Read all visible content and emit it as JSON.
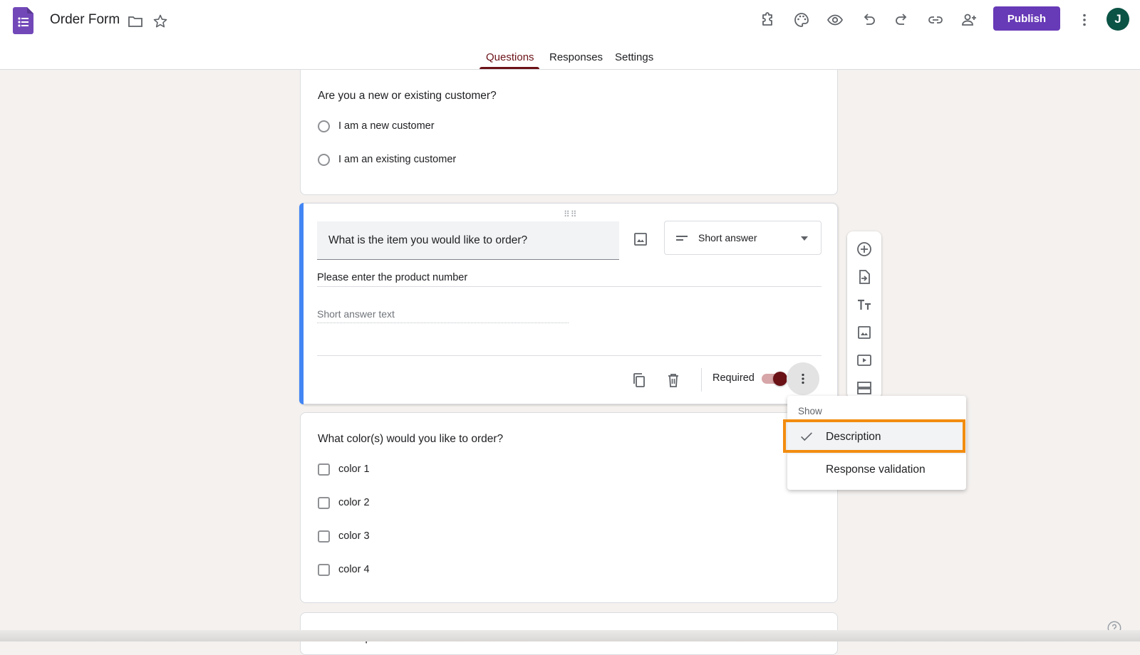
{
  "header": {
    "doc_title": "Order Form",
    "publish_label": "Publish",
    "avatar_initial": "J"
  },
  "tabs": [
    {
      "label": "Questions",
      "active": true
    },
    {
      "label": "Responses",
      "active": false
    },
    {
      "label": "Settings",
      "active": false
    }
  ],
  "questions": [
    {
      "title": "Are you a new or existing customer?",
      "type": "radio",
      "options": [
        "I am a new customer",
        "I am an existing customer"
      ]
    },
    {
      "title": "What is the item you would like to order?",
      "type_label": "Short answer",
      "description": "Please enter the product number",
      "placeholder": "Short answer text",
      "required_label": "Required",
      "required": true
    },
    {
      "title": "What color(s) would you like to order?",
      "type": "checkbox",
      "options": [
        "color 1",
        "color 2",
        "color 3",
        "color 4"
      ]
    },
    {
      "title": "Product options"
    }
  ],
  "menu": {
    "header": "Show",
    "items": [
      {
        "label": "Description",
        "checked": true
      },
      {
        "label": "Response validation",
        "checked": false
      }
    ]
  },
  "colors": {
    "accent": "#673ab7",
    "theme": "#6b1217",
    "highlight": "#f28c0f",
    "active_bar": "#4285f4"
  }
}
